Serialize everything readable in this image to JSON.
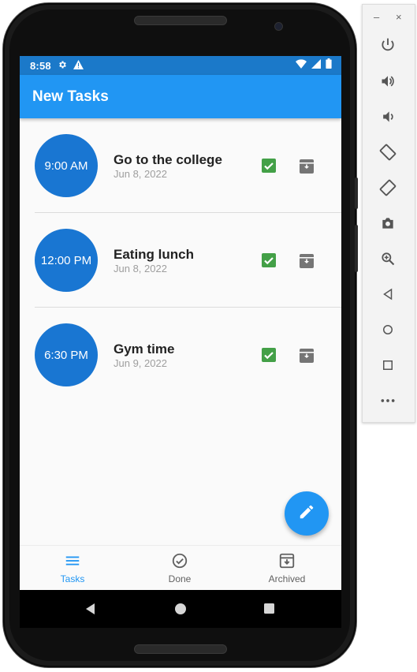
{
  "status_bar": {
    "time": "8:58"
  },
  "app_bar": {
    "title": "New Tasks"
  },
  "tasks": [
    {
      "time": "9:00 AM",
      "title": "Go to the college",
      "date": "Jun 8, 2022"
    },
    {
      "time": "12:00 PM",
      "title": "Eating lunch",
      "date": "Jun 8, 2022"
    },
    {
      "time": "6:30 PM",
      "title": "Gym time",
      "date": "Jun 9, 2022"
    }
  ],
  "bottom_nav": {
    "items": [
      {
        "label": "Tasks",
        "icon": "menu-icon",
        "active": true
      },
      {
        "label": "Done",
        "icon": "check-circle-icon",
        "active": false
      },
      {
        "label": "Archived",
        "icon": "archive-icon",
        "active": false
      }
    ]
  },
  "fab": {
    "icon": "edit-icon"
  },
  "colors": {
    "primary": "#2196f3",
    "status_bar": "#1b79c9",
    "time_circle": "#1976d2",
    "check": "#43a047",
    "archive": "#757575"
  },
  "emulator_toolbar": {
    "buttons": [
      "power-icon",
      "volume-up-icon",
      "volume-down-icon",
      "rotate-left-icon",
      "rotate-right-icon",
      "camera-icon",
      "zoom-icon",
      "back-icon",
      "home-icon",
      "overview-icon",
      "more-icon"
    ]
  }
}
